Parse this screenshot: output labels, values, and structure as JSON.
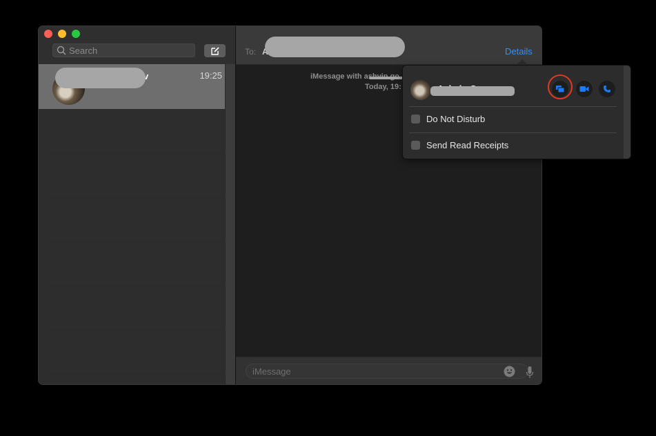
{
  "window": {
    "traffic_lights": [
      "close",
      "minimize",
      "maximize"
    ]
  },
  "sidebar": {
    "search": {
      "placeholder": "Search",
      "value": ""
    },
    "compose_icon": "compose-icon",
    "conversations": [
      {
        "name_visible_tail": "v",
        "time": "19:25",
        "name_redacted": true,
        "selected": true
      }
    ]
  },
  "header": {
    "to_label": "To:",
    "to_value_visible": "Ad",
    "details_label": "Details"
  },
  "thread": {
    "info_line": "iMessage with ashvin go",
    "time_line": "Today, 19:"
  },
  "composer": {
    "placeholder": "iMessage",
    "emoji_icon": "emoji-icon",
    "mic_icon": "microphone-icon"
  },
  "details_popover": {
    "contact_name": "Ashvin G",
    "actions": [
      {
        "name": "screen-share",
        "icon": "screen-share-icon",
        "highlighted": true
      },
      {
        "name": "facetime-video",
        "icon": "video-camera-icon",
        "highlighted": false
      },
      {
        "name": "audio-call",
        "icon": "phone-icon",
        "highlighted": false
      }
    ],
    "options": [
      {
        "label": "Do Not Disturb",
        "checked": false
      },
      {
        "label": "Send Read Receipts",
        "checked": false
      }
    ]
  },
  "colors": {
    "accent": "#3b8ff0",
    "highlight_ring": "#e23a22",
    "close": "#fe5f57",
    "minimize": "#febc2e",
    "maximize": "#28c840"
  }
}
